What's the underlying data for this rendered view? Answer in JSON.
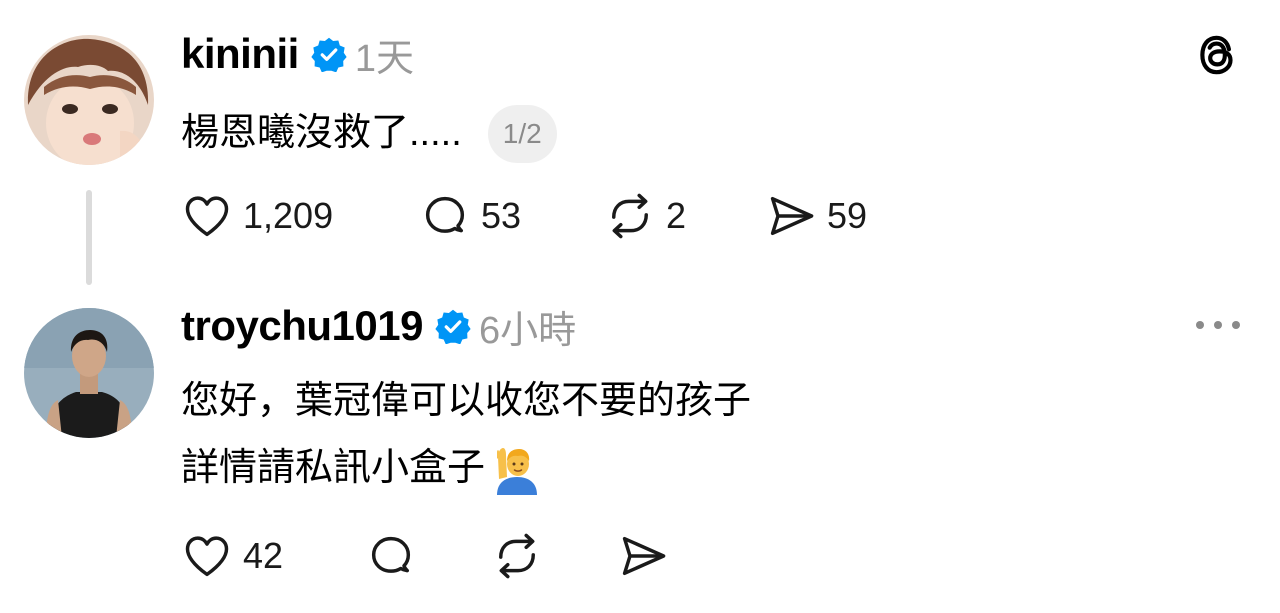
{
  "posts": [
    {
      "username": "kininii",
      "time": "1天",
      "text": "楊恩曦沒救了.....",
      "pagination": "1/2",
      "likes": "1,209",
      "replies": "53",
      "reposts": "2",
      "shares": "59"
    },
    {
      "username": "troychu1019",
      "time": "6小時",
      "text_lines": [
        "您好，葉冠偉可以收您不要的孩子",
        "詳情請私訊小盒子"
      ],
      "likes": "42"
    }
  ],
  "icons": {
    "verified": "verified-badge-icon",
    "like": "heart-icon",
    "reply": "comment-icon",
    "repost": "repost-icon",
    "share": "send-icon",
    "app_logo": "threads-logo-icon",
    "more": "more-options-icon",
    "emoji": "person-raising-hand-emoji"
  },
  "colors": {
    "verified": "#0095f6",
    "secondary_text": "#999999",
    "thread_line": "#dbdbdb",
    "pill_background": "#efefef"
  }
}
